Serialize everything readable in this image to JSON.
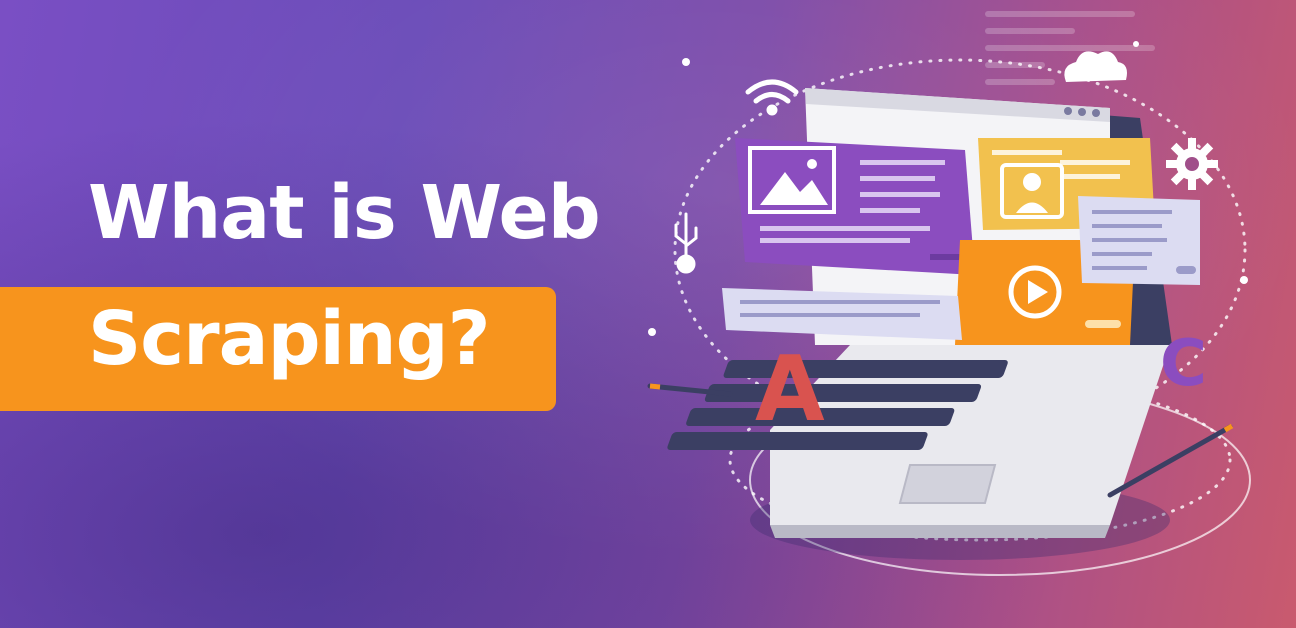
{
  "banner": {
    "title_line1": "What is Web",
    "title_line2": "Scraping?",
    "letter_a": "A",
    "letter_c": "C",
    "colors": {
      "background_start": "#7a4fc4",
      "background_end": "#c95a6e",
      "accent_orange": "#f7941d",
      "panel_purple": "#8b4dbf",
      "panel_yellow": "#f2c14e",
      "title_text": "#ffffff"
    },
    "icons": [
      "wifi-icon",
      "cloud-icon",
      "gear-icon",
      "usb-icon",
      "image-icon",
      "user-icon",
      "play-icon",
      "pencil-icon"
    ]
  }
}
